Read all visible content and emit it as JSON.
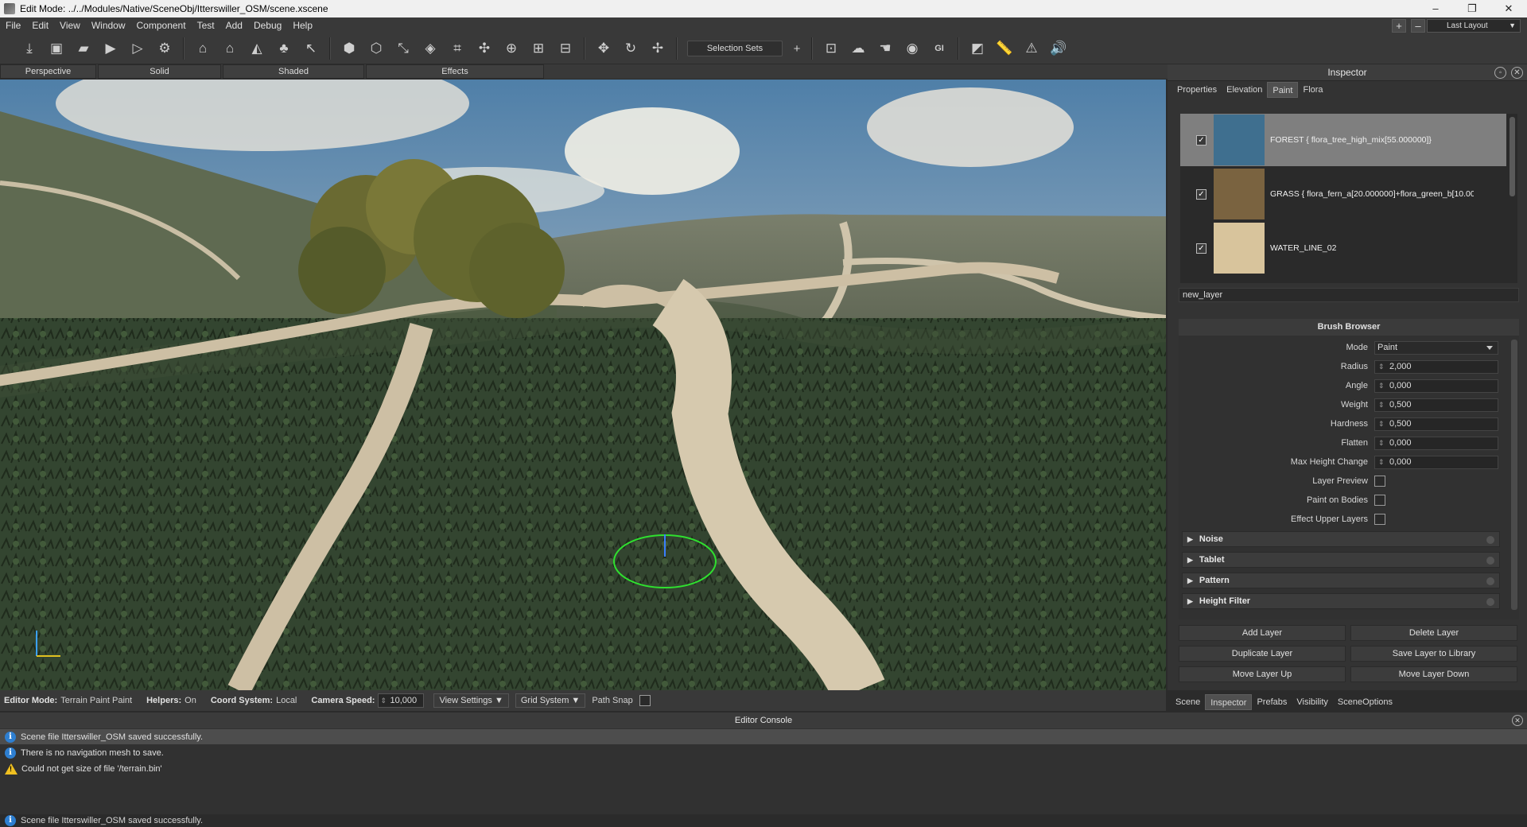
{
  "window": {
    "title": "Edit Mode: ../../Modules/Native/SceneObj/Itterswiller_OSM/scene.xscene",
    "minimize": "–",
    "restore": "❐",
    "close": "✕"
  },
  "menu": [
    "File",
    "Edit",
    "View",
    "Window",
    "Component",
    "Test",
    "Add",
    "Debug",
    "Help"
  ],
  "layout": {
    "add": "+",
    "remove": "–",
    "selected": "Last Layout"
  },
  "toolbar": {
    "selection_sets": "Selection Sets",
    "add": "+",
    "icons": [
      "save-all-icon",
      "save-icon",
      "open-icon",
      "play-icon",
      "play-outline-icon",
      "build-icon",
      "terrain-icon",
      "terrain-edit-icon",
      "terrain-paint-icon",
      "flora-icon",
      "cursor-icon",
      "cube-icon",
      "cube-add-icon",
      "scale-icon",
      "cube-cut-icon",
      "structure-icon",
      "puzzle-icon",
      "node-icon",
      "link-icon",
      "group-icon",
      "move-icon",
      "rotate-icon",
      "transform-icon",
      "browser-icon",
      "cloud-icon",
      "pointer-icon",
      "sphere-icon",
      "gi-icon",
      "box-icon",
      "ruler-icon",
      "alert-icon",
      "sound-icon"
    ]
  },
  "viewtabs": [
    "Perspective",
    "Solid",
    "Shaded",
    "Effects"
  ],
  "inspector": {
    "title": "Inspector",
    "tabs": [
      "Properties",
      "Elevation",
      "Paint",
      "Flora"
    ],
    "active_tab": "Paint",
    "layers": [
      {
        "name": "FOREST {  flora_tree_high_mix[55.000000]}",
        "checked": "✓",
        "thumb": "#3f6f8f"
      },
      {
        "name": "GRASS {  flora_fern_a[20.000000]+flora_green_b[10.000...",
        "checked": "✓",
        "thumb": "#7a6340"
      },
      {
        "name": "WATER_LINE_02",
        "checked": "✓",
        "thumb": "#d8c49c"
      }
    ],
    "new_layer": "new_layer",
    "brush": {
      "title": "Brush Browser",
      "mode_label": "Mode",
      "mode": "Paint",
      "radius_label": "Radius",
      "radius": "2,000",
      "angle_label": "Angle",
      "angle": "0,000",
      "weight_label": "Weight",
      "weight": "0,500",
      "hardness_label": "Hardness",
      "hardness": "0,500",
      "flatten_label": "Flatten",
      "flatten": "0,000",
      "maxh_label": "Max Height Change",
      "maxh": "0,000",
      "layer_preview": "Layer Preview",
      "paint_bodies": "Paint on Bodies",
      "effect_upper": "Effect Upper Layers",
      "sections": [
        "Noise",
        "Tablet",
        "Pattern",
        "Height Filter"
      ]
    },
    "buttons": {
      "add": "Add Layer",
      "delete": "Delete Layer",
      "duplicate": "Duplicate Layer",
      "save": "Save Layer to Library",
      "up": "Move Layer Up",
      "down": "Move Layer Down"
    }
  },
  "bottom_tabs": [
    "Scene",
    "Inspector",
    "Prefabs",
    "Visibility",
    "SceneOptions"
  ],
  "status": {
    "mode_label": "Editor Mode:",
    "mode": "Terrain Paint Paint",
    "helpers_label": "Helpers:",
    "helpers": "On",
    "coord_label": "Coord System:",
    "coord": "Local",
    "speed_label": "Camera Speed:",
    "speed": "10,000",
    "view_settings": "View Settings ▼",
    "grid_system": "Grid System ▼",
    "path_snap": "Path Snap"
  },
  "console": {
    "title": "Editor Console",
    "messages": [
      {
        "type": "info",
        "text": "Scene file Itterswiller_OSM saved successfully."
      },
      {
        "type": "info",
        "text": "There is no navigation mesh to save."
      },
      {
        "type": "warn",
        "text": "Could not get size of file '/terrain.bin'"
      }
    ],
    "footer": "Scene file Itterswiller_OSM saved successfully."
  }
}
